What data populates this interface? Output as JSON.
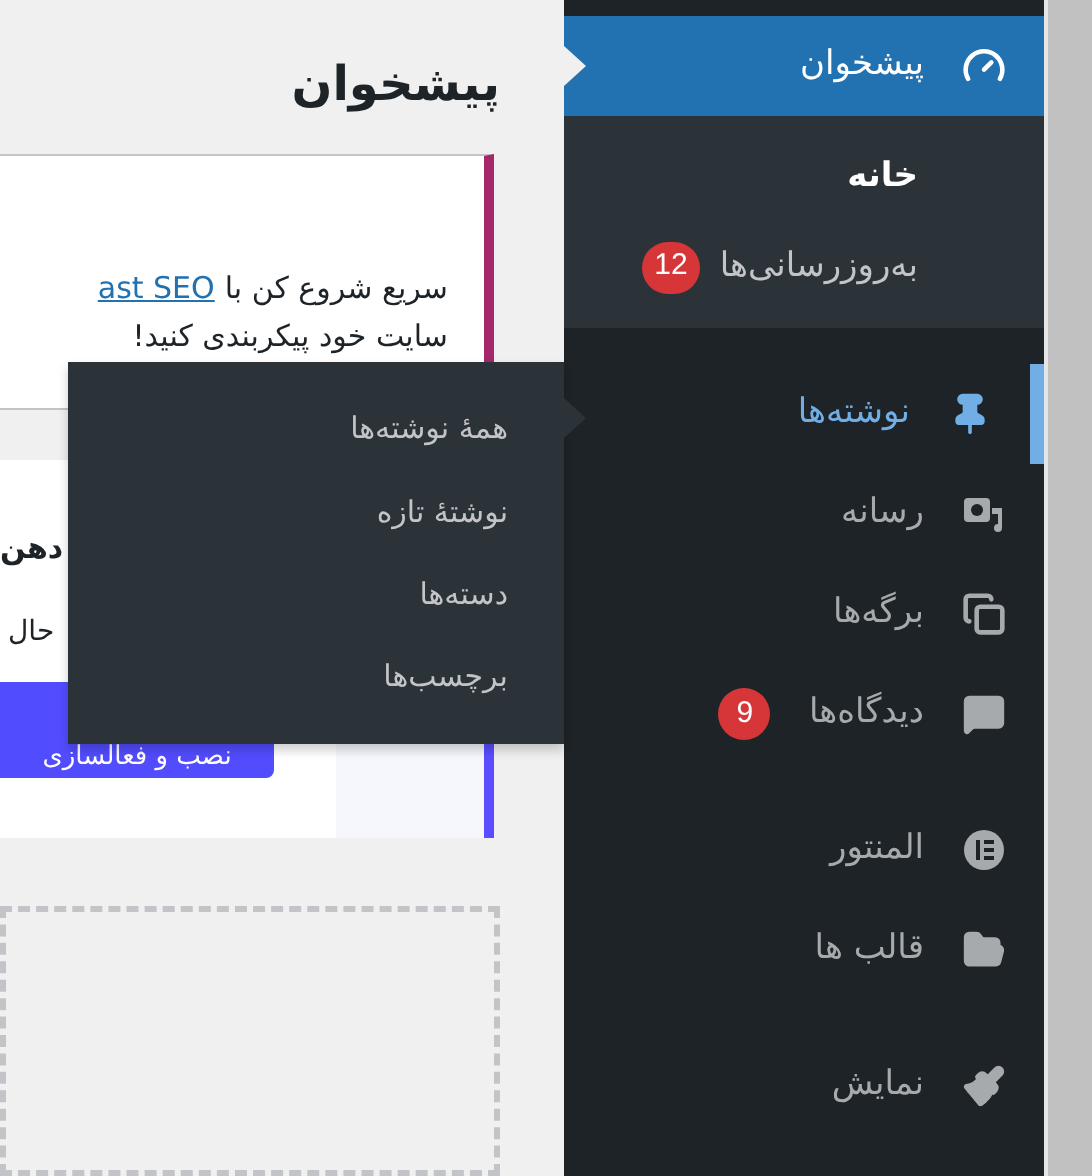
{
  "page_title": "پیشخوان",
  "notice": {
    "text": "سریع شروع کن با",
    "link": "ast SEO",
    "line_2": "سایت خود پیکربندی کنید!"
  },
  "promo": {
    "heading": "دهن",
    "text": "حال",
    "button": "نصب و فعالسازی"
  },
  "sidebar": {
    "groups": [
      [
        {
          "label": "پیشخوان",
          "kind": "dashboard",
          "selected": true,
          "hovered": false,
          "children": [
            {
              "label": "خانه",
              "selected": true
            },
            {
              "label": "به‌روزرسانی‌ها",
              "selected": false,
              "badge": "12"
            }
          ]
        },
        {
          "label": "نوشته‌ها",
          "kind": "pin",
          "selected": false,
          "hovered": true
        },
        {
          "label": "رسانه",
          "kind": "media",
          "selected": false,
          "hovered": false
        },
        {
          "label": "برگه‌ها",
          "kind": "pages",
          "selected": false,
          "hovered": false
        },
        {
          "label": "دیدگاه‌ها",
          "kind": "comments",
          "selected": false,
          "hovered": false,
          "badge": "9"
        }
      ],
      [
        {
          "label": "المنتور",
          "kind": "elementor",
          "selected": false,
          "hovered": false
        },
        {
          "label": "قالب ها",
          "kind": "folder",
          "selected": false,
          "hovered": false
        }
      ],
      [
        {
          "label": "نمایش",
          "kind": "brush",
          "selected": false,
          "hovered": false
        }
      ]
    ]
  },
  "flyout": {
    "items": [
      {
        "label": "همهٔ نوشته‌ها"
      },
      {
        "label": "نوشتهٔ تازه"
      },
      {
        "label": "دسته‌ها"
      },
      {
        "label": "برچسب‌ها"
      }
    ]
  }
}
